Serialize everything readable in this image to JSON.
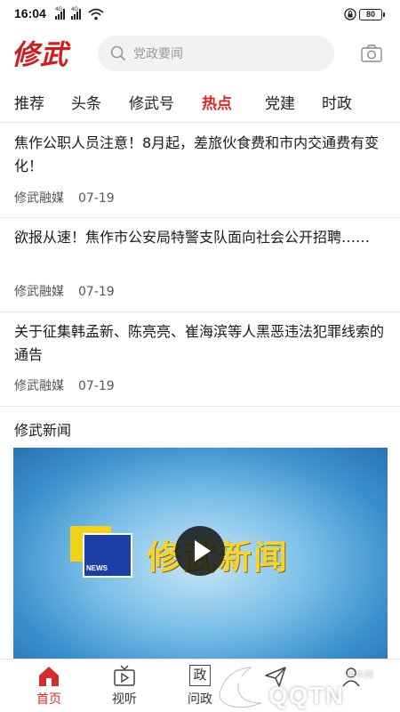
{
  "status_bar": {
    "time": "16:04",
    "signal_1_label": "4G",
    "signal_2_label": "4G",
    "battery": "80"
  },
  "header": {
    "logo": "修武",
    "search_placeholder": "党政要闻"
  },
  "tabs": [
    {
      "label": "推荐",
      "active": false
    },
    {
      "label": "头条",
      "active": false
    },
    {
      "label": "修武号",
      "active": false
    },
    {
      "label": "热点",
      "active": true
    },
    {
      "label": "党建",
      "active": false
    },
    {
      "label": "时政",
      "active": false
    }
  ],
  "news": [
    {
      "title": "焦作公职人员注意！8月起，差旅伙食费和市内交通费有变化！",
      "source": "修武融媒",
      "date": "07-19"
    },
    {
      "title": "欲报从速！焦作市公安局特警支队面向社会公开招聘……",
      "source": "修武融媒",
      "date": "07-19"
    },
    {
      "title": "关于征集韩孟新、陈亮亮、崔海滨等人黑恶违法犯罪线索的通告",
      "source": "修武融媒",
      "date": "07-19"
    }
  ],
  "section": {
    "title": "修武新闻"
  },
  "video": {
    "badge": "NEWS",
    "title": "修武新闻"
  },
  "bottom_nav": [
    {
      "label": "首页",
      "icon": "home-icon",
      "active": true
    },
    {
      "label": "视听",
      "icon": "tv-icon",
      "active": false
    },
    {
      "label": "问政",
      "icon": "zheng-icon",
      "icon_char": "政",
      "active": false
    },
    {
      "label": "",
      "icon": "send-icon",
      "active": false
    },
    {
      "label": "",
      "icon": "user-icon",
      "active": false
    }
  ],
  "watermark": {
    "text": "QQTN",
    "small": "腾牛网"
  },
  "colors": {
    "accent": "#d42b2b",
    "logo": "#cc1f1f"
  }
}
